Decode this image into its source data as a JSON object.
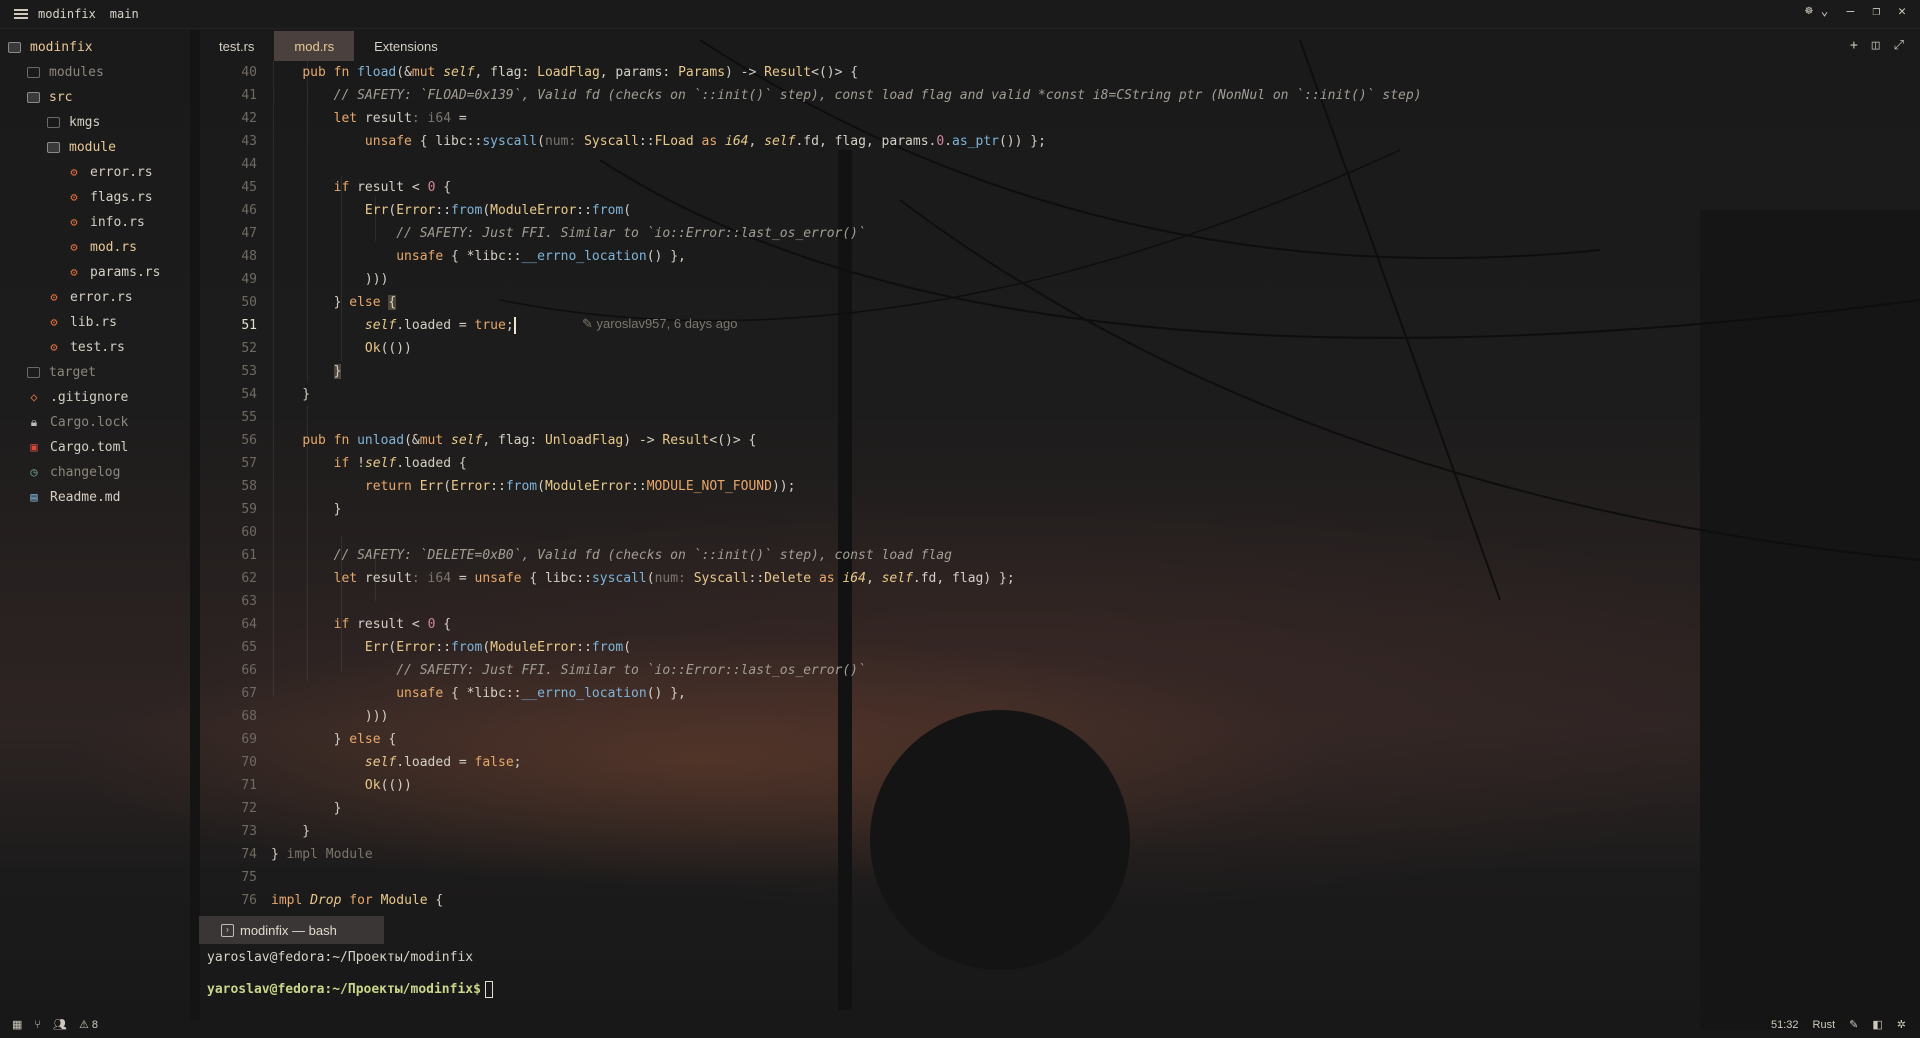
{
  "titlebar": {
    "project": "modinfix",
    "branch": "main"
  },
  "sidebar": {
    "root": "modinfix",
    "items": [
      {
        "label": "modules"
      },
      {
        "label": "src"
      },
      {
        "label": "kmgs"
      },
      {
        "label": "module"
      },
      {
        "label": "error.rs"
      },
      {
        "label": "flags.rs"
      },
      {
        "label": "info.rs"
      },
      {
        "label": "mod.rs"
      },
      {
        "label": "params.rs"
      },
      {
        "label": "error.rs"
      },
      {
        "label": "lib.rs"
      },
      {
        "label": "test.rs"
      },
      {
        "label": "target"
      },
      {
        "label": ".gitignore"
      },
      {
        "label": "Cargo.lock"
      },
      {
        "label": "Cargo.toml"
      },
      {
        "label": "changelog"
      },
      {
        "label": "Readme.md"
      }
    ]
  },
  "tabs": [
    {
      "label": "test.rs"
    },
    {
      "label": "mod.rs"
    },
    {
      "label": "Extensions"
    }
  ],
  "editor": {
    "line_numbers": [
      "40",
      "41",
      "42",
      "43",
      "44",
      "45",
      "46",
      "47",
      "48",
      "49",
      "50",
      "51",
      "52",
      "53",
      "54",
      "55",
      "56",
      "57",
      "58",
      "59",
      "60",
      "61",
      "62",
      "63",
      "64",
      "65",
      "66",
      "67",
      "68",
      "69",
      "70",
      "71",
      "72",
      "73",
      "74",
      "75",
      "76"
    ],
    "blame": "yaroslav957, 6 days ago"
  },
  "terminal": {
    "tab_label": "modinfix — bash",
    "line1": "yaroslav@fedora:~/Проекты/modinfix",
    "prompt": "yaroslav@fedora:~/Проекты/modinfix$"
  },
  "status": {
    "warnings": "8",
    "position": "51:32",
    "language": "Rust"
  }
}
